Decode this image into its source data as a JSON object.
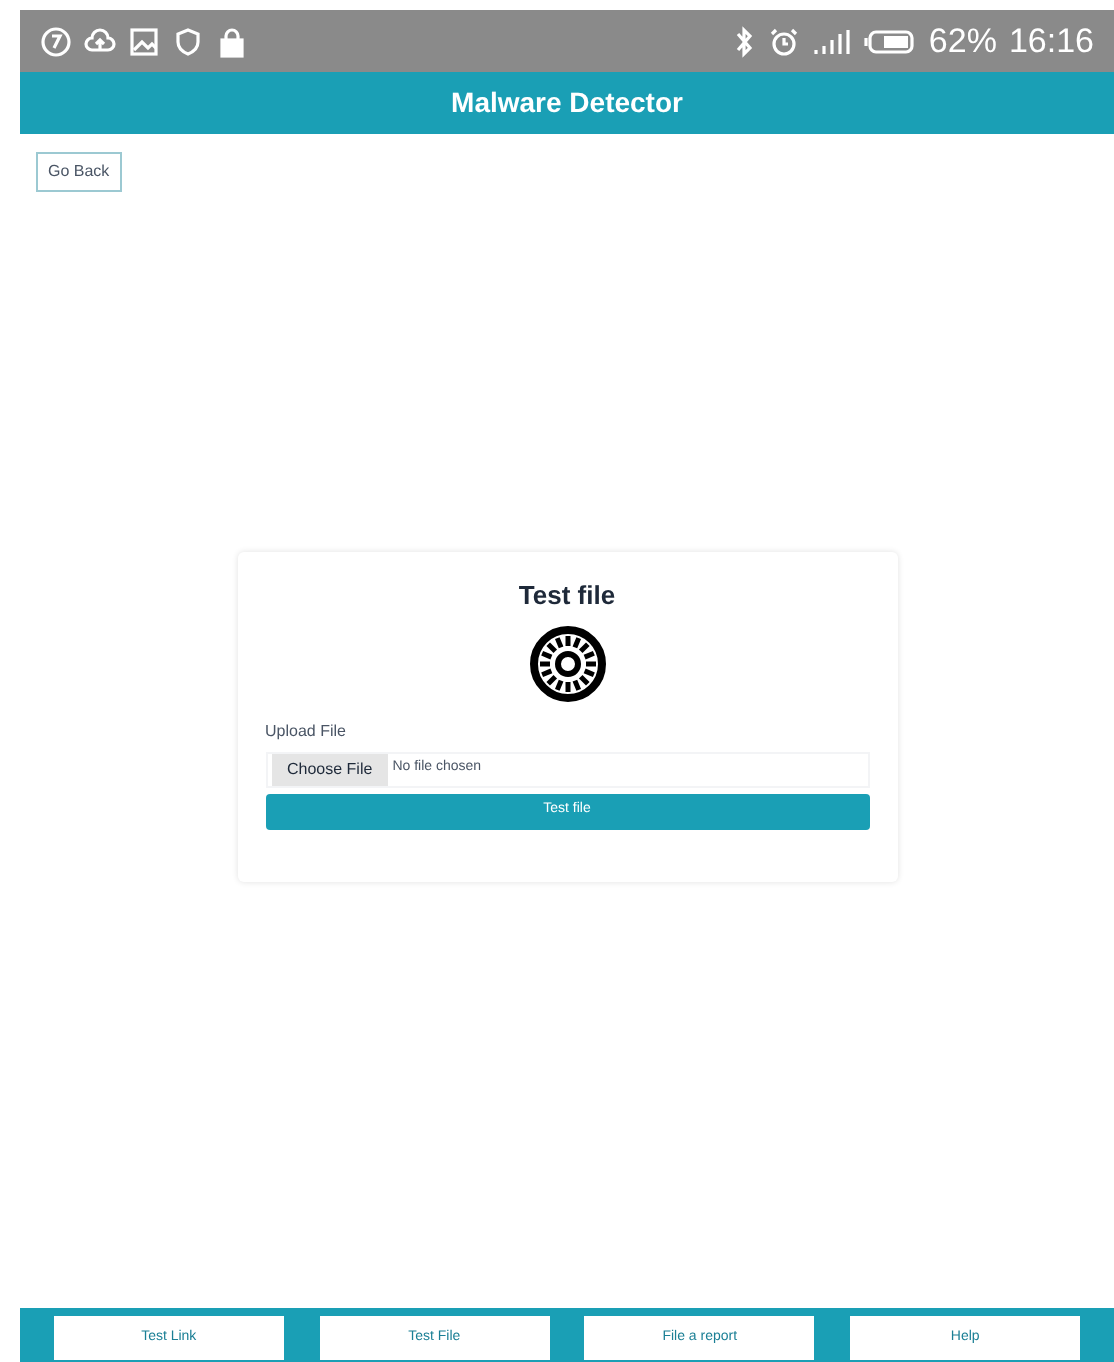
{
  "status_bar": {
    "battery": "62%",
    "time": "16:16"
  },
  "header": {
    "title": "Malware Detector"
  },
  "back_button": "Go Back",
  "card": {
    "title": "Test file",
    "upload_label": "Upload File",
    "file_button": "Choose File",
    "file_status": "No file chosen",
    "submit": "Test file"
  },
  "bottom_nav": [
    {
      "label": "Test Link"
    },
    {
      "label": "Test File"
    },
    {
      "label": "File a report"
    },
    {
      "label": "Help"
    }
  ]
}
